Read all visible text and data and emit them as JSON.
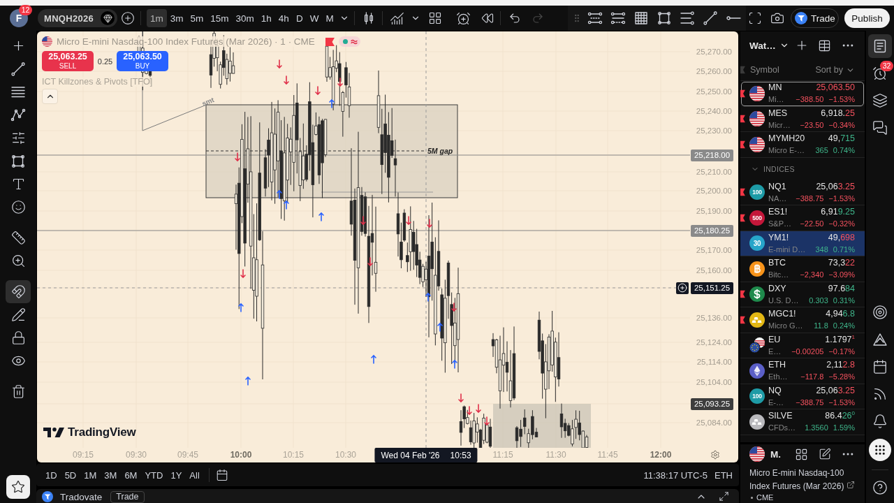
{
  "toolbar": {
    "avatar": {
      "initial": "F",
      "badge": "12"
    },
    "symbol": "MNQH2026",
    "intervals": [
      {
        "label": "1m",
        "selected": true
      },
      {
        "label": "3m",
        "selected": false
      },
      {
        "label": "5m",
        "selected": false
      },
      {
        "label": "15m",
        "selected": false
      },
      {
        "label": "30m",
        "selected": false
      },
      {
        "label": "1h",
        "selected": false
      },
      {
        "label": "4h",
        "selected": false
      },
      {
        "label": "D",
        "selected": false
      },
      {
        "label": "W",
        "selected": false
      },
      {
        "label": "M",
        "selected": false
      }
    ],
    "history": [
      {
        "kind": "undo",
        "disabled": false
      },
      {
        "kind": "redo",
        "disabled": true
      }
    ],
    "trade_button": "Trade",
    "publish_button": "Publish"
  },
  "left_toolbar": {
    "groups": [
      {
        "tools": [
          {
            "kind": "crosshair",
            "selected": false
          },
          {
            "kind": "trend-line",
            "selected": false
          },
          {
            "kind": "fib",
            "selected": false
          },
          {
            "kind": "pattern",
            "selected": false
          },
          {
            "kind": "forecast",
            "selected": false
          },
          {
            "kind": "shapes",
            "selected": false
          },
          {
            "kind": "text",
            "selected": false
          },
          {
            "kind": "emoji",
            "selected": false
          }
        ]
      },
      {
        "tools": [
          {
            "kind": "measure",
            "selected": false
          },
          {
            "kind": "zoom",
            "selected": false
          }
        ]
      },
      {
        "tools": [
          {
            "kind": "magnet",
            "selected": true
          },
          {
            "kind": "stay-drawing",
            "selected": false
          },
          {
            "kind": "lock",
            "selected": false
          },
          {
            "kind": "hide",
            "selected": false
          }
        ]
      },
      {
        "tools": [
          {
            "kind": "remove",
            "selected": false
          }
        ]
      }
    ]
  },
  "chart": {
    "legend": {
      "title": "Micro E-mini Nasdaq-100 Index Futures (Mar 2026) · 1 · CME",
      "flagged": true,
      "market_open": true
    },
    "order_panel": {
      "sell_price": "25,063.25",
      "sell_label": "SELL",
      "spread": "0.25",
      "buy_price": "25,063.50",
      "buy_label": "BUY"
    },
    "indicator": "ICT Killzones & Pivots [TFO]",
    "legend_expanded": true,
    "drawing_labels": [
      {
        "kind": "trendline",
        "text": "smt"
      },
      {
        "kind": "zone",
        "text": "5M gap"
      }
    ],
    "price_axis": [
      {
        "kind": "tick",
        "text": "25,270.00"
      },
      {
        "kind": "tick",
        "text": "25,260.00"
      },
      {
        "kind": "tick",
        "text": "25,250.00"
      },
      {
        "kind": "tick",
        "text": "25,240.00"
      },
      {
        "kind": "tick",
        "text": "25,230.00"
      },
      {
        "kind": "line",
        "text": "25,218.00"
      },
      {
        "kind": "tick",
        "text": "25,210.00"
      },
      {
        "kind": "tick",
        "text": "25,200.00"
      },
      {
        "kind": "tick",
        "text": "25,190.00"
      },
      {
        "kind": "line",
        "text": "25,180.25"
      },
      {
        "kind": "tick",
        "text": "25,170.00"
      },
      {
        "kind": "tick",
        "text": "25,160.00"
      },
      {
        "kind": "crosshair",
        "text": "25,151.25"
      },
      {
        "kind": "tick",
        "text": "25,136.00"
      },
      {
        "kind": "tick",
        "text": "25,124.00"
      },
      {
        "kind": "tick",
        "text": "25,114.00"
      },
      {
        "kind": "tick",
        "text": "25,104.00"
      },
      {
        "kind": "marker",
        "text": "25,093.25"
      },
      {
        "kind": "tick",
        "text": "25,084.00"
      }
    ],
    "time_axis": [
      {
        "text": "09:15",
        "major": false
      },
      {
        "text": "09:30",
        "major": false
      },
      {
        "text": "09:45",
        "major": false
      },
      {
        "text": "10:00",
        "major": true
      },
      {
        "text": "10:15",
        "major": false
      },
      {
        "text": "10:30",
        "major": false
      },
      {
        "text": "11:15",
        "major": false
      },
      {
        "text": "11:30",
        "major": false
      },
      {
        "text": "11:45",
        "major": false
      },
      {
        "text": "12:00",
        "major": true
      }
    ],
    "crosshair_time": {
      "date": "Wed 04 Feb '26",
      "time": "10:53"
    },
    "logo": "TradingView"
  },
  "range_bar": {
    "ranges": [
      {
        "label": "1D",
        "selected": false
      },
      {
        "label": "5D",
        "selected": false
      },
      {
        "label": "1M",
        "selected": false
      },
      {
        "label": "3M",
        "selected": false
      },
      {
        "label": "6M",
        "selected": false
      },
      {
        "label": "YTD",
        "selected": false
      },
      {
        "label": "1Y",
        "selected": false
      },
      {
        "label": "All",
        "selected": false
      }
    ],
    "clock": "11:38:17 UTC-5",
    "session": "ETH"
  },
  "bottom_panel": {
    "broker": "Tradovate",
    "trade_button": "Trade"
  },
  "watchlist": {
    "title": "Wat…",
    "symbol_header": "Symbol",
    "sort_label": "Sort by",
    "rows": [
      {
        "kind": "symbol",
        "symbol": "MN",
        "description": "Mi…",
        "price_tick": "25,063.50",
        "tick_up": false,
        "change": "−388.50",
        "change_percent": "−1.53%",
        "up": false,
        "flagged": true,
        "active": true,
        "selected": false,
        "logo": {
          "kind": "us-flag"
        }
      },
      {
        "kind": "symbol",
        "symbol": "MES",
        "description": "Micr…",
        "price_base": "6,918.",
        "price_tick": "25",
        "tick_up": false,
        "change": "−23.50",
        "change_percent": "−0.34%",
        "up": false,
        "flagged": true,
        "active": false,
        "selected": false,
        "logo": {
          "kind": "us-flag"
        }
      },
      {
        "kind": "symbol",
        "symbol": "MYMH20",
        "description": "Micro E-…",
        "price_base": "49,",
        "price_tick": "715",
        "tick_up": true,
        "change": "365",
        "change_percent": "0.74%",
        "up": true,
        "flagged": true,
        "active": false,
        "selected": false,
        "logo": {
          "kind": "us-flag"
        }
      },
      {
        "kind": "section",
        "label": "INDICES",
        "expanded": true
      },
      {
        "kind": "symbol",
        "symbol": "NQ1",
        "description": "NA…",
        "price_base": "25,06",
        "price_tick": "3.25",
        "tick_up": false,
        "change": "−388.75",
        "change_percent": "−1.53%",
        "up": false,
        "flagged": true,
        "active": false,
        "selected": false,
        "logo": {
          "kind": "index",
          "text": "100",
          "color": "#1e9ba6"
        }
      },
      {
        "kind": "symbol",
        "symbol": "ES1!",
        "description": "S&P…",
        "price_base": "6,91",
        "price_tick": "9.25",
        "tick_up": true,
        "change": "−22.50",
        "change_percent": "−0.32%",
        "up": false,
        "flagged": true,
        "active": false,
        "selected": false,
        "logo": {
          "kind": "index",
          "text": "500",
          "color": "#c4173a"
        }
      },
      {
        "kind": "symbol",
        "symbol": "YM1!",
        "description": "E-mini D…",
        "price_base": "49,",
        "price_tick": "698",
        "tick_up": false,
        "change": "348",
        "change_percent": "0.71%",
        "up": true,
        "flagged": false,
        "active": false,
        "selected": true,
        "logo": {
          "kind": "index",
          "text": "30",
          "color": "#27a5c9"
        }
      },
      {
        "kind": "symbol",
        "symbol": "BTC",
        "description": "Bitc…",
        "price_base": "73,3",
        "price_tick": "22",
        "tick_up": false,
        "change": "−2,340",
        "change_percent": "−3.09%",
        "up": false,
        "flagged": false,
        "active": false,
        "selected": false,
        "logo": {
          "kind": "bitcoin"
        }
      },
      {
        "kind": "symbol",
        "symbol": "DXY",
        "description": "U.S. D…",
        "price_base": "97.6",
        "price_tick": "84",
        "tick_up": true,
        "change": "0.303",
        "change_percent": "0.31%",
        "up": true,
        "flagged": true,
        "active": false,
        "selected": false,
        "logo": {
          "kind": "dollar"
        }
      },
      {
        "kind": "symbol",
        "symbol": "MGC1!",
        "description": "Micro G…",
        "price_base": "4,94",
        "price_tick": "6.8",
        "tick_up": true,
        "change": "11.8",
        "change_percent": "0.24%",
        "up": true,
        "flagged": true,
        "active": false,
        "selected": false,
        "logo": {
          "kind": "gold"
        }
      },
      {
        "kind": "symbol",
        "symbol": "EU",
        "description": "E…",
        "price_base": "1.1797",
        "price_tick": "$^{1}$",
        "tick_up": false,
        "change": "−0.00205",
        "change_percent": "−0.17%",
        "up": false,
        "flagged": false,
        "active": false,
        "selected": false,
        "logo": {
          "kind": "euro-dollar"
        }
      },
      {
        "kind": "symbol",
        "symbol": "ETH",
        "description": "Eth…",
        "price_base": "2,11",
        "price_tick": "2.8",
        "tick_up": false,
        "change": "−117.8",
        "change_percent": "−5.28%",
        "up": false,
        "flagged": false,
        "active": false,
        "selected": false,
        "logo": {
          "kind": "ether"
        }
      },
      {
        "kind": "symbol",
        "symbol": "NQ",
        "description": "E-…",
        "price_base": "25,06",
        "price_tick": "3.25",
        "tick_up": false,
        "change": "−388.75",
        "change_percent": "−1.53%",
        "up": false,
        "flagged": false,
        "active": false,
        "selected": false,
        "logo": {
          "kind": "index",
          "text": "100",
          "color": "#1e9ba6"
        }
      },
      {
        "kind": "symbol",
        "symbol": "SILVE",
        "description": "CFDs…",
        "price_base": "86.4",
        "price_tick": "26$^{0}$",
        "tick_up": true,
        "change": "1.3560",
        "change_percent": "1.59%",
        "up": true,
        "flagged": false,
        "active": false,
        "selected": false,
        "logo": {
          "kind": "silver"
        }
      }
    ]
  },
  "details": {
    "symbol": "M.",
    "name": "Micro E-mini Nasdaq-100 Index Futures (Mar 2026)",
    "exchange": "CME"
  },
  "right_rail": {
    "top_tools": [
      {
        "kind": "watchlist",
        "selected": true
      },
      {
        "kind": "alerts",
        "selected": false,
        "badge": "32"
      },
      {
        "kind": "objects",
        "selected": false
      },
      {
        "kind": "chats",
        "selected": false
      }
    ],
    "bottom_tools": [
      {
        "kind": "screener",
        "selected": false
      },
      {
        "kind": "ideas",
        "selected": false
      },
      {
        "kind": "calendar",
        "selected": false
      },
      {
        "kind": "stream",
        "selected": false
      },
      {
        "kind": "notifications",
        "selected": false
      },
      {
        "kind": "apps",
        "selected": false
      },
      {
        "kind": "help",
        "selected": false
      }
    ]
  }
}
